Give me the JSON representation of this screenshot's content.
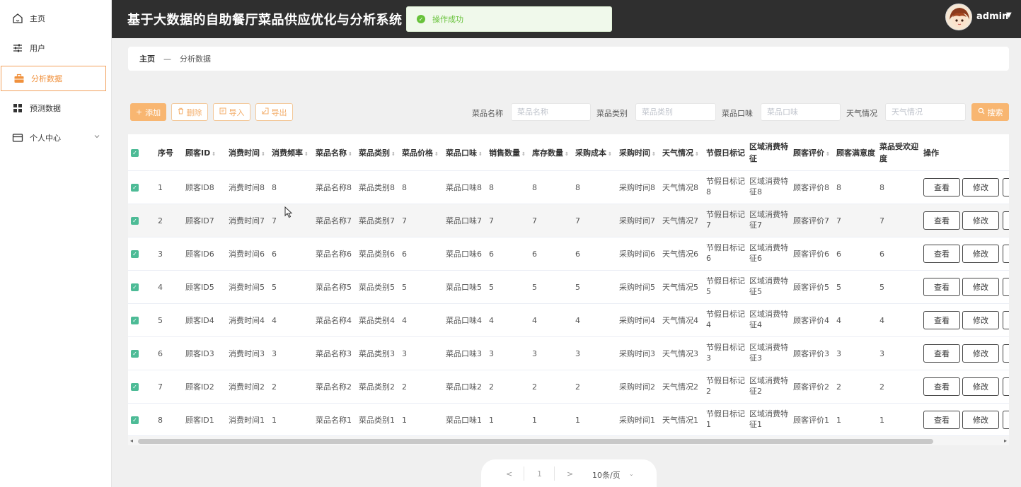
{
  "sidebar": {
    "items": [
      {
        "label": "主页",
        "icon": "home-icon"
      },
      {
        "label": "用户",
        "icon": "sliders-icon"
      },
      {
        "label": "分析数据",
        "icon": "briefcase-icon"
      },
      {
        "label": "预测数据",
        "icon": "grid-icon"
      },
      {
        "label": "个人中心",
        "icon": "card-icon"
      }
    ]
  },
  "header": {
    "title": "基于大数据的自助餐厅菜品供应优化与分析系统",
    "toast": "操作成功",
    "user": "admin"
  },
  "breadcrumb": {
    "home": "主页",
    "sep": "—",
    "current": "分析数据"
  },
  "toolbar": {
    "add": "添加",
    "delete": "删除",
    "import": "导入",
    "export": "导出",
    "search": "搜索",
    "filters": [
      {
        "label": "菜品名称",
        "placeholder": "菜品名称"
      },
      {
        "label": "菜品类别",
        "placeholder": "菜品类别"
      },
      {
        "label": "菜品口味",
        "placeholder": "菜品口味"
      },
      {
        "label": "天气情况",
        "placeholder": "天气情况"
      }
    ]
  },
  "table": {
    "headers": [
      "序号",
      "顾客ID",
      "消费时间",
      "消费频率",
      "菜品名称",
      "菜品类别",
      "菜品价格",
      "菜品口味",
      "销售数量",
      "库存数量",
      "采购成本",
      "采购时间",
      "天气情况",
      "节假日标记",
      "区域消费特征",
      "顾客评价",
      "顾客满意度",
      "菜品受欢迎度",
      "操作"
    ],
    "rows": [
      {
        "no": "1",
        "cid": "顾客ID8",
        "time": "消费时间8",
        "freq": "8",
        "name": "菜品名称8",
        "cat": "菜品类别8",
        "price": "8",
        "taste": "菜品口味8",
        "sales": "8",
        "stock": "8",
        "cost": "8",
        "ptime": "采购时间8",
        "weather": "天气情况8",
        "hol1": "节假日标记",
        "hol2": "8",
        "reg1": "区域消费特",
        "reg2": "征8",
        "review": "顾客评价8",
        "sat": "8",
        "pop": "8"
      },
      {
        "no": "2",
        "cid": "顾客ID7",
        "time": "消费时间7",
        "freq": "7",
        "name": "菜品名称7",
        "cat": "菜品类别7",
        "price": "7",
        "taste": "菜品口味7",
        "sales": "7",
        "stock": "7",
        "cost": "7",
        "ptime": "采购时间7",
        "weather": "天气情况7",
        "hol1": "节假日标记",
        "hol2": "7",
        "reg1": "区域消费特",
        "reg2": "征7",
        "review": "顾客评价7",
        "sat": "7",
        "pop": "7"
      },
      {
        "no": "3",
        "cid": "顾客ID6",
        "time": "消费时间6",
        "freq": "6",
        "name": "菜品名称6",
        "cat": "菜品类别6",
        "price": "6",
        "taste": "菜品口味6",
        "sales": "6",
        "stock": "6",
        "cost": "6",
        "ptime": "采购时间6",
        "weather": "天气情况6",
        "hol1": "节假日标记",
        "hol2": "6",
        "reg1": "区域消费特",
        "reg2": "征6",
        "review": "顾客评价6",
        "sat": "6",
        "pop": "6"
      },
      {
        "no": "4",
        "cid": "顾客ID5",
        "time": "消费时间5",
        "freq": "5",
        "name": "菜品名称5",
        "cat": "菜品类别5",
        "price": "5",
        "taste": "菜品口味5",
        "sales": "5",
        "stock": "5",
        "cost": "5",
        "ptime": "采购时间5",
        "weather": "天气情况5",
        "hol1": "节假日标记",
        "hol2": "5",
        "reg1": "区域消费特",
        "reg2": "征5",
        "review": "顾客评价5",
        "sat": "5",
        "pop": "5"
      },
      {
        "no": "5",
        "cid": "顾客ID4",
        "time": "消费时间4",
        "freq": "4",
        "name": "菜品名称4",
        "cat": "菜品类别4",
        "price": "4",
        "taste": "菜品口味4",
        "sales": "4",
        "stock": "4",
        "cost": "4",
        "ptime": "采购时间4",
        "weather": "天气情况4",
        "hol1": "节假日标记",
        "hol2": "4",
        "reg1": "区域消费特",
        "reg2": "征4",
        "review": "顾客评价4",
        "sat": "4",
        "pop": "4"
      },
      {
        "no": "6",
        "cid": "顾客ID3",
        "time": "消费时间3",
        "freq": "3",
        "name": "菜品名称3",
        "cat": "菜品类别3",
        "price": "3",
        "taste": "菜品口味3",
        "sales": "3",
        "stock": "3",
        "cost": "3",
        "ptime": "采购时间3",
        "weather": "天气情况3",
        "hol1": "节假日标记",
        "hol2": "3",
        "reg1": "区域消费特",
        "reg2": "征3",
        "review": "顾客评价3",
        "sat": "3",
        "pop": "3"
      },
      {
        "no": "7",
        "cid": "顾客ID2",
        "time": "消费时间2",
        "freq": "2",
        "name": "菜品名称2",
        "cat": "菜品类别2",
        "price": "2",
        "taste": "菜品口味2",
        "sales": "2",
        "stock": "2",
        "cost": "2",
        "ptime": "采购时间2",
        "weather": "天气情况2",
        "hol1": "节假日标记",
        "hol2": "2",
        "reg1": "区域消费特",
        "reg2": "征2",
        "review": "顾客评价2",
        "sat": "2",
        "pop": "2"
      },
      {
        "no": "8",
        "cid": "顾客ID1",
        "time": "消费时间1",
        "freq": "1",
        "name": "菜品名称1",
        "cat": "菜品类别1",
        "price": "1",
        "taste": "菜品口味1",
        "sales": "1",
        "stock": "1",
        "cost": "1",
        "ptime": "采购时间1",
        "weather": "天气情况1",
        "hol1": "节假日标记",
        "hol2": "1",
        "reg1": "区域消费特",
        "reg2": "征1",
        "review": "顾客评价1",
        "sat": "1",
        "pop": "1"
      }
    ],
    "actions": {
      "view": "查看",
      "edit": "修改"
    }
  },
  "pagination": {
    "prev": "<",
    "page": "1",
    "next": ">",
    "size": "10条/页"
  },
  "colors": {
    "accent": "#f8b671",
    "header_bg": "#2f2f2f",
    "check": "#4dbb96",
    "success": "#67c23a"
  }
}
